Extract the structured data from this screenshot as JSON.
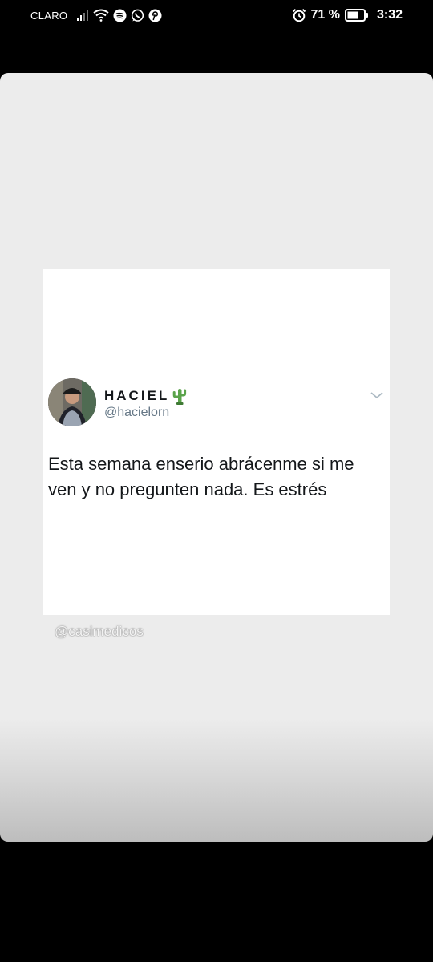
{
  "status_bar": {
    "carrier": "CLARO",
    "battery_percent": "71 %",
    "time": "3:32",
    "icons_left": [
      "signal-icon",
      "wifi-icon",
      "spotify-icon",
      "whatsapp-icon",
      "pinterest-icon"
    ],
    "icons_right": [
      "alarm-icon",
      "battery-icon"
    ],
    "battery_level": 0.71
  },
  "tweet": {
    "display_name": "HACIEL",
    "name_emoji": "cactus-icon",
    "handle": "@hacielorn",
    "text": "Esta semana enserio abrácenme si me ven y no pregunten nada. Es estrés"
  },
  "story": {
    "watermark": "@casimedicos"
  },
  "colors": {
    "story_background": "#ececec",
    "tweet_text": "#14171a",
    "handle_text": "#657786"
  }
}
